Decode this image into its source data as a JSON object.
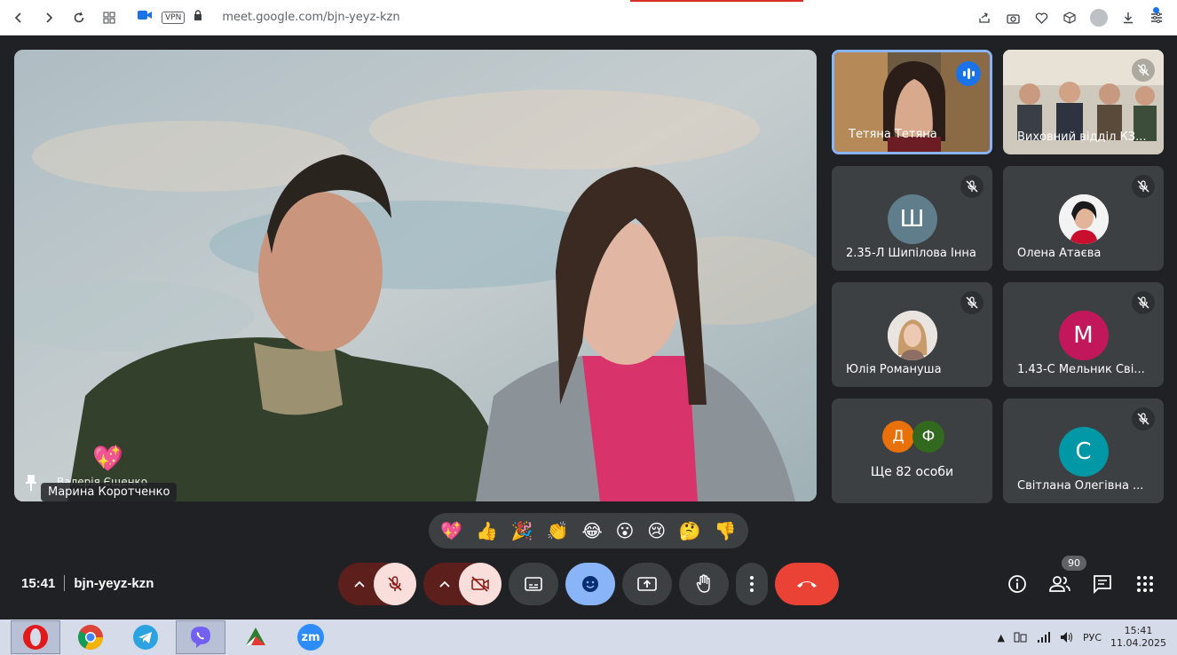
{
  "browser": {
    "url": "meet.google.com/bjn-yeyz-kzn",
    "vpn_label": "VPN"
  },
  "main_video": {
    "speaker_tag": "Марина Коротченко",
    "hidden_name": "Валерія Єщенко"
  },
  "tiles": [
    {
      "name": "Тетяна Тетяна",
      "type": "video",
      "speaking": true
    },
    {
      "name": "Виховний відділ КЗ...",
      "type": "video",
      "muted": true
    },
    {
      "name": "2.35-Л Шипілова Інна",
      "type": "letter",
      "letter": "Ш",
      "color": "#607d8b",
      "muted": true
    },
    {
      "name": "Олена Атаєва",
      "type": "photo",
      "muted": true
    },
    {
      "name": "Юлія Романуша",
      "type": "photo",
      "muted": true
    },
    {
      "name": "1.43-С Мельник Сві...",
      "type": "letter",
      "letter": "М",
      "color": "#c2185b",
      "muted": true
    },
    {
      "name": "Ще 82 особи",
      "type": "group",
      "letters": [
        "Д",
        "Ф"
      ]
    },
    {
      "name": "Світлана Олегівна ...",
      "type": "letter",
      "letter": "С",
      "color": "#0097a7",
      "muted": true
    }
  ],
  "reactions": [
    "💖",
    "👍",
    "🎉",
    "👏",
    "😂",
    "😮",
    "😢",
    "🤔",
    "👎"
  ],
  "bottom": {
    "time": "15:41",
    "meeting_code": "bjn-yeyz-kzn",
    "participants_count": "90"
  },
  "taskbar": {
    "apps": [
      "opera",
      "chrome",
      "telegram",
      "viber",
      "mediaget",
      "zoom"
    ],
    "zoom_label": "zm",
    "lang": "РУС",
    "clock_time": "15:41",
    "clock_date": "11.04.2025"
  },
  "colors": {
    "meet_bg": "#202124",
    "tile_bg": "#3c4043",
    "end_call": "#ea4335",
    "active_border": "#8ab4f8"
  }
}
